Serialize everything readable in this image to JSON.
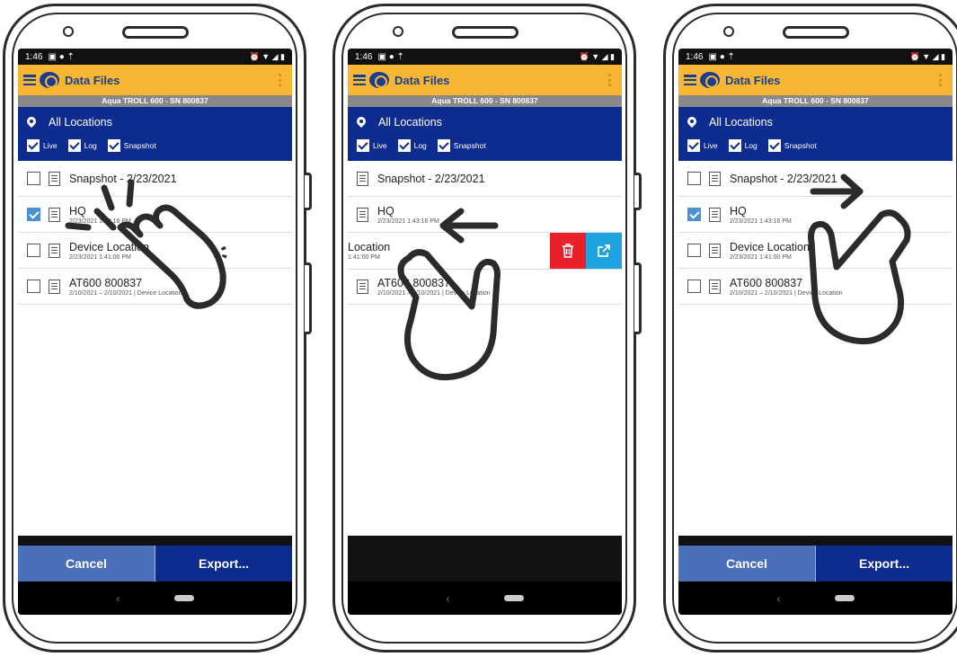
{
  "common": {
    "time": "1:46",
    "app_title": "Data Files",
    "device": "Aqua TROLL 600 - SN 800837",
    "location": "All Locations",
    "filters": [
      "Live",
      "Log",
      "Snapshot"
    ],
    "cancel_label": "Cancel",
    "export_label": "Export..."
  },
  "phone1": {
    "items": [
      {
        "name": "Snapshot - 2/23/2021",
        "sub": "",
        "checked": false
      },
      {
        "name": "HQ",
        "sub": "2/23/2021 1:43:16 PM",
        "checked": true
      },
      {
        "name": "Device Location",
        "sub": "2/23/2021 1:41:00 PM",
        "checked": false
      },
      {
        "name": "AT600 800837",
        "sub": "2/10/2021 – 2/10/2021 | Device Location",
        "checked": false
      }
    ]
  },
  "phone2": {
    "items": [
      {
        "name": "Snapshot - 2/23/2021",
        "sub": ""
      },
      {
        "name": "HQ",
        "sub": "2/23/2021 1:43:16 PM"
      },
      {
        "name": "Location",
        "sub": "1:41:00 PM"
      },
      {
        "name": "AT600 800837",
        "sub": "2/10/2021 – 2/10/2021 | Device Location"
      }
    ]
  },
  "phone3": {
    "items": [
      {
        "name": "Snapshot - 2/23/2021",
        "sub": "",
        "checked": false
      },
      {
        "name": "HQ",
        "sub": "2/23/2021 1:43:16 PM",
        "checked": true
      },
      {
        "name": "Device Location",
        "sub": "2/23/2021 1:41:00 PM",
        "checked": false
      },
      {
        "name": "AT600 800837",
        "sub": "2/10/2021 – 2/10/2021 | Device Location",
        "checked": false
      }
    ]
  },
  "colors": {
    "appbar": "#f7b733",
    "locbar": "#0e2c8f",
    "delete": "#e8202a",
    "share": "#1fa3e0"
  },
  "gestures": [
    "tap-hand",
    "swipe-left-hand",
    "swipe-right-hand"
  ]
}
